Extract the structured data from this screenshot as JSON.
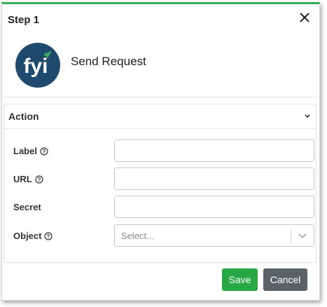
{
  "dialog": {
    "title": "Step 1",
    "close_icon": "close-icon"
  },
  "action": {
    "logo_text": "fyi",
    "name": "Send Request"
  },
  "section": {
    "title": "Action",
    "chevron_icon": "chevron-down-icon"
  },
  "fields": {
    "label": {
      "label": "Label",
      "value": ""
    },
    "url": {
      "label": "URL",
      "value": ""
    },
    "secret": {
      "label": "Secret",
      "value": ""
    },
    "object": {
      "label": "Object",
      "placeholder": "Select..."
    }
  },
  "buttons": {
    "save": "Save",
    "cancel": "Cancel"
  },
  "colors": {
    "accent": "#3aaa5c",
    "save": "#28a745",
    "cancel": "#5a6268",
    "logo_bg": "#1f4a6e",
    "logo_mark": "#3aaa5c"
  }
}
